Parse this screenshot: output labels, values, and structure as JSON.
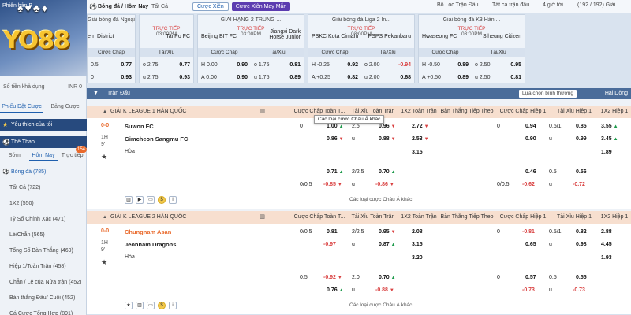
{
  "sidebar": {
    "top_label": "Phiên bản B",
    "logo_text": "YO88",
    "balance_label": "Số tiền khả dụng",
    "balance_value": "INR 0",
    "tabs": [
      "Phiếu Đặt Cược",
      "Bảng Cược"
    ],
    "favorites": "Yêu thích của tôi",
    "sports": "Thể Thao",
    "day_tabs": [
      "Sớm",
      "Hôm Nay",
      "Trực tiếp"
    ],
    "live_badge": "154",
    "items": [
      "Bóng đá (785)",
      "Tất Cả (722)",
      "1X2 (550)",
      "Tỷ Số Chính Xác (471)",
      "Lẻ/Chẵn (565)",
      "Tổng Số Bàn Thắng (469)",
      "Hiệp 1/Toàn Trận (458)",
      "Chẵn / Lẻ của Nửa trận (452)",
      "Bàn thắng Đầu/ Cuối (452)",
      "Cá Cược Tổng Hợp (891)"
    ]
  },
  "topbar": {
    "breadcrumb": "Bóng đá / Hôm Nay",
    "select_all": "Tất Cả",
    "btn_bet": "Cược Xiên",
    "btn_lucky": "Cược Xiên May Mắn",
    "filter": "Bộ Lọc Trận Đấu",
    "all_matches": "Tất cả trận đấu",
    "time": "4 giờ tới",
    "count": "(192 / 192) Giải"
  },
  "cards": [
    {
      "league": "Giải bóng đá Ngoại h...",
      "teamA": "ern District",
      "teamB": "Tai Po FC",
      "live": "TRỰC TIẾP",
      "time": "03:00PM",
      "h1": "Cược Chấp",
      "h2": "Tài/Xỉu",
      "rows": [
        [
          "0.5",
          "0.77",
          "o 2.75",
          "0.77"
        ],
        [
          "0",
          "0.93",
          "u 2.75",
          "0.93"
        ]
      ]
    },
    {
      "league": "GIẢI HẠNG 2 TRUNG ...",
      "teamA": "Beijing BIT FC",
      "teamB": "Jiangxi Dark Horse Junior",
      "live": "TRỰC TIẾP",
      "time": "03:00PM",
      "h1": "Cược Chấp",
      "h2": "Tài/Xỉu",
      "rows": [
        [
          "H 0.00",
          "0.90",
          "o 1.75",
          "0.81"
        ],
        [
          "A 0.00",
          "0.90",
          "u 1.75",
          "0.89"
        ]
      ]
    },
    {
      "league": "Giải bóng đá Liga 2 In...",
      "teamA": "PSKC Kota Cimahi",
      "teamB": "PSPS Pekanbaru",
      "live": "TRỰC TIẾP",
      "time": "03:00PM",
      "h1": "Cược Chấp",
      "h2": "Tài/Xỉu",
      "rows": [
        [
          "H -0.25",
          "0.92",
          "o 2.00",
          "-0.94"
        ],
        [
          "A +0.25",
          "0.82",
          "u 2.00",
          "0.68"
        ]
      ]
    },
    {
      "league": "Giải bóng đá K3 Hàn ...",
      "teamA": "Hwaseong FC",
      "teamB": "Siheung Citizen",
      "live": "TRỰC TIẾP",
      "time": "03:00PM",
      "h1": "Cược Chấp",
      "h2": "Tài/Xỉu",
      "rows": [
        [
          "H -0.50",
          "0.89",
          "o 2.50",
          "0.95"
        ],
        [
          "A +0.50",
          "0.89",
          "u 2.50",
          "0.81"
        ]
      ]
    }
  ],
  "section": {
    "title": "Trận Đấu",
    "view": "Lựa chọn bình thường",
    "half": "Hai Dòng"
  },
  "columns": [
    "Cược Chấp Toàn T...",
    "Tài Xỉu Toàn Trận",
    "1X2 Toàn Trận",
    "Bàn Thắng Tiếp Theo",
    "Cược Chấp Hiệp 1",
    "Tài Xỉu Hiệp 1",
    "1X2 Hiệp 1"
  ],
  "leagues": [
    {
      "name": "GIẢI K LEAGUE 1 HÀN QUỐC",
      "score": "0-0",
      "half": "1H",
      "minute": "9'",
      "home": "Suwon FC",
      "away": "Gimcheon Sangmu FC",
      "draw": "Hòa",
      "home_orange": false,
      "main": {
        "ft_hdp": [
          "0",
          "1.00",
          "",
          "0.86"
        ],
        "ft_ou": [
          "2.5",
          "0.96",
          "u",
          "0.88"
        ],
        "ft_1x2": [
          "2.72",
          "2.53",
          "3.15"
        ],
        "h1_hdp": [
          "0",
          "0.94",
          "",
          "0.90"
        ],
        "h1_ou": [
          "0.5/1",
          "0.85",
          "u",
          "0.99"
        ],
        "h1_1x2": [
          "3.55",
          "3.45",
          "1.89"
        ]
      },
      "alt": {
        "ft_hdp": [
          "",
          "0.71",
          "0/0.5",
          "-0.85"
        ],
        "ft_ou": [
          "2/2.5",
          "0.70",
          "u",
          "-0.86"
        ],
        "h1_hdp": [
          "",
          "0.46",
          "0/0.5",
          "-0.62"
        ],
        "h1_ou": [
          "0.5",
          "0.56",
          "u",
          "-0.72"
        ]
      },
      "more": "Các loại cược Châu Á khác"
    },
    {
      "name": "GIẢI K LEAGUE 2 HÀN QUỐC",
      "score": "0-0",
      "half": "1H",
      "minute": "9'",
      "home": "Chungnam Asan",
      "away": "Jeonnam Dragons",
      "draw": "Hòa",
      "home_orange": true,
      "main": {
        "ft_hdp": [
          "0/0.5",
          "0.81",
          "",
          "-0.97"
        ],
        "ft_ou": [
          "2/2.5",
          "0.95",
          "u",
          "0.87"
        ],
        "ft_1x2": [
          "2.08",
          "3.15",
          "3.20"
        ],
        "h1_hdp": [
          "0",
          "-0.81",
          "",
          "0.65"
        ],
        "h1_ou": [
          "0.5/1",
          "0.82",
          "u",
          "0.98"
        ],
        "h1_1x2": [
          "2.88",
          "4.45",
          "1.93"
        ]
      },
      "alt": {
        "ft_hdp": [
          "0.5",
          "-0.92",
          "",
          "0.76"
        ],
        "ft_ou": [
          "2.0",
          "0.70",
          "u",
          "-0.88"
        ],
        "h1_hdp": [
          "0",
          "0.57",
          "",
          "-0.73"
        ],
        "h1_ou": [
          "0.5",
          "0.55",
          "u",
          "-0.73"
        ]
      },
      "more": "Các loại cược Châu Á khác"
    }
  ],
  "tooltip": "Các loại cược Châu Á khác"
}
